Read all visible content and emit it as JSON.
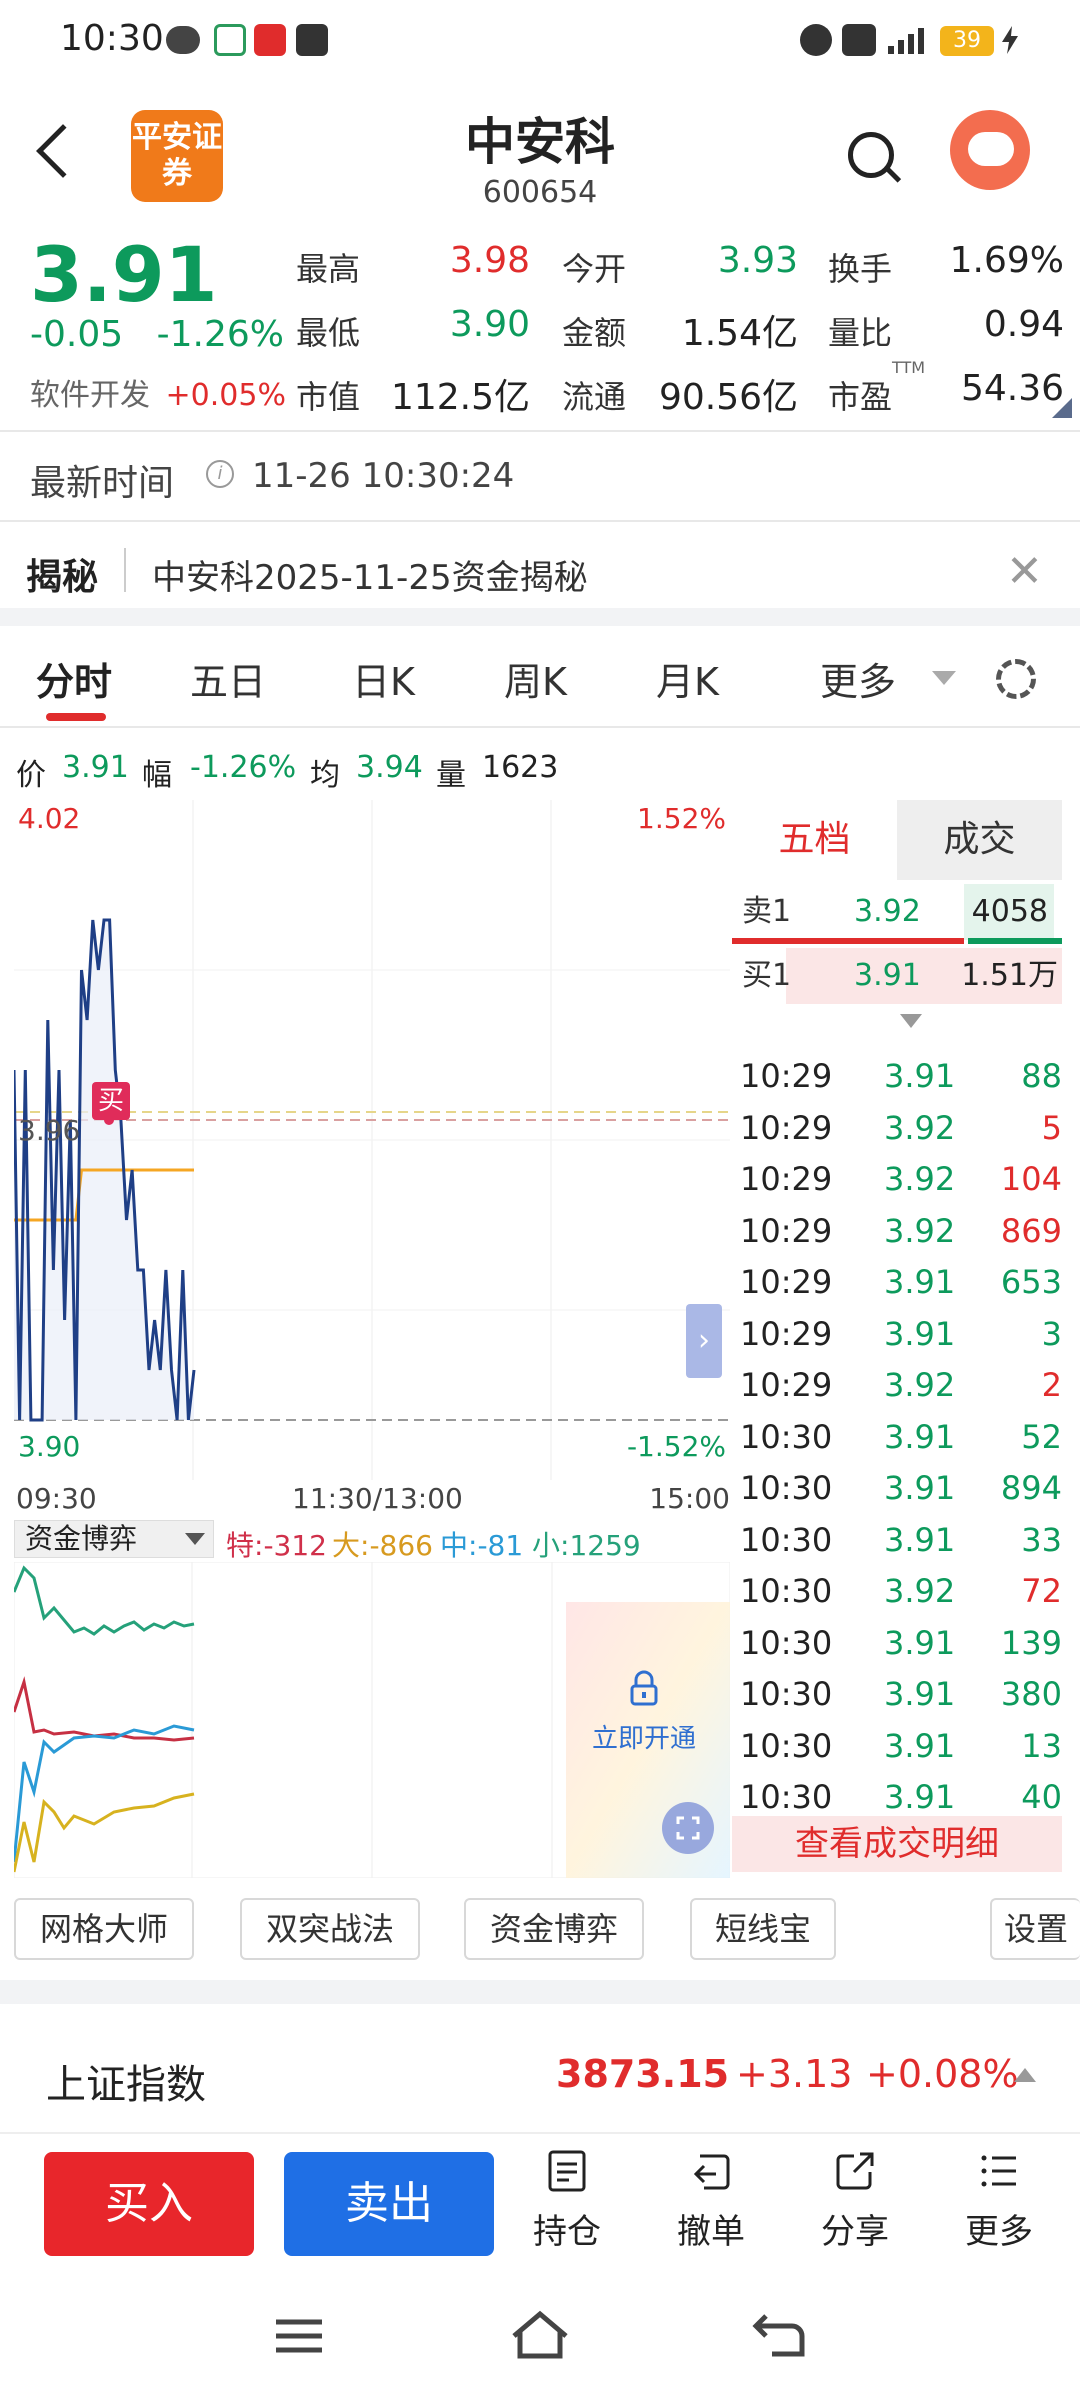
{
  "status_bar": {
    "time": "10:30",
    "battery": "39"
  },
  "header": {
    "logo_text": "平安证券",
    "stock_name": "中安科",
    "stock_code": "600654"
  },
  "quote": {
    "price": "3.91",
    "change": "-0.05",
    "change_pct": "-1.26%",
    "sector_name": "软件开发",
    "sector_pct": "+0.05%",
    "fields": [
      {
        "label": "最高",
        "value": "3.98"
      },
      {
        "label": "今开",
        "value": "3.93"
      },
      {
        "label": "换手",
        "value": "1.69%"
      },
      {
        "label": "最低",
        "value": "3.90"
      },
      {
        "label": "金额",
        "value": "1.54亿"
      },
      {
        "label": "量比",
        "value": "0.94"
      },
      {
        "label": "市值",
        "value": "112.5亿"
      },
      {
        "label": "流通",
        "value": "90.56亿"
      },
      {
        "label": "市盈",
        "value": "54.36",
        "sup": "TTM"
      }
    ]
  },
  "update": {
    "label": "最新时间",
    "time": "11-26 10:30:24"
  },
  "reveal": {
    "tag": "揭秘",
    "text": "中安科2025-11-25资金揭秘"
  },
  "tabs": [
    "分时",
    "五日",
    "日K",
    "周K",
    "月K",
    "更多"
  ],
  "chart_info": {
    "price_label": "价",
    "price": "3.91",
    "amp_label": "幅",
    "amp": "-1.26%",
    "avg_label": "均",
    "avg": "3.94",
    "vol_label": "量",
    "vol": "1623"
  },
  "chart_data": {
    "type": "line",
    "y_max_label": "4.02",
    "y_min_label": "3.90",
    "y_max_pct": "1.52%",
    "y_min_pct": "-1.52%",
    "ref_label": "3.96",
    "buy_marker": "买",
    "ylim": [
      3.9,
      4.02
    ],
    "ref_value": 3.96,
    "x_labels": [
      "09:30",
      "11:30/13:00",
      "15:00"
    ],
    "series": [
      {
        "values": [
          3.97,
          3.9,
          3.97,
          3.9,
          3.9,
          3.9,
          3.98,
          3.93,
          3.97,
          3.92,
          3.96,
          3.9,
          3.99,
          3.98,
          4.0,
          3.99,
          4.0,
          4.0,
          3.97,
          3.96,
          3.94,
          3.95,
          3.93,
          3.93,
          3.91,
          3.92,
          3.91,
          3.93,
          3.91,
          3.9,
          3.93,
          3.9,
          3.91
        ]
      },
      {
        "values": [
          3.94,
          3.94,
          3.94,
          3.94,
          3.94,
          3.94,
          3.94,
          3.94,
          3.94,
          3.94,
          3.94,
          3.94,
          3.95,
          3.95,
          3.95,
          3.95,
          3.95,
          3.95,
          3.95,
          3.95,
          3.95,
          3.95,
          3.95,
          3.95,
          3.95,
          3.95,
          3.95,
          3.95,
          3.95,
          3.95,
          3.95,
          3.95,
          3.95
        ]
      }
    ]
  },
  "flow": {
    "title": "资金博弈",
    "special_label": "特:",
    "special": "-312",
    "large_label": "大:",
    "large": "-866",
    "medium_label": "中:",
    "medium": "-81",
    "small_label": "小:",
    "small": "1259",
    "unlock_text": "立即开通"
  },
  "book": {
    "tab_active": "五档",
    "tab_other": "成交",
    "ask": {
      "label": "卖1",
      "price": "3.92",
      "vol": "4058"
    },
    "bid": {
      "label": "买1",
      "price": "3.91",
      "vol": "1.51万"
    },
    "ticks": [
      {
        "t": "10:29",
        "p": "3.91",
        "v": "88",
        "dir": "down"
      },
      {
        "t": "10:29",
        "p": "3.92",
        "v": "5",
        "dir": "up"
      },
      {
        "t": "10:29",
        "p": "3.92",
        "v": "104",
        "dir": "up"
      },
      {
        "t": "10:29",
        "p": "3.92",
        "v": "869",
        "dir": "up"
      },
      {
        "t": "10:29",
        "p": "3.91",
        "v": "653",
        "dir": "down"
      },
      {
        "t": "10:29",
        "p": "3.91",
        "v": "3",
        "dir": "down"
      },
      {
        "t": "10:29",
        "p": "3.92",
        "v": "2",
        "dir": "up"
      },
      {
        "t": "10:30",
        "p": "3.91",
        "v": "52",
        "dir": "down"
      },
      {
        "t": "10:30",
        "p": "3.91",
        "v": "894",
        "dir": "down"
      },
      {
        "t": "10:30",
        "p": "3.91",
        "v": "33",
        "dir": "down"
      },
      {
        "t": "10:30",
        "p": "3.92",
        "v": "72",
        "dir": "up"
      },
      {
        "t": "10:30",
        "p": "3.91",
        "v": "139",
        "dir": "down"
      },
      {
        "t": "10:30",
        "p": "3.91",
        "v": "380",
        "dir": "down"
      },
      {
        "t": "10:30",
        "p": "3.91",
        "v": "13",
        "dir": "down"
      },
      {
        "t": "10:30",
        "p": "3.91",
        "v": "40",
        "dir": "down"
      }
    ],
    "detail_button": "查看成交明细"
  },
  "tools": [
    "网格大师",
    "双突战法",
    "资金博弈",
    "短线宝",
    "设置"
  ],
  "index": {
    "name": "上证指数",
    "value": "3873.15",
    "change": "+3.13",
    "pct": "+0.08%"
  },
  "bottom": {
    "buy": "买入",
    "sell": "卖出",
    "nav": [
      "持仓",
      "撤单",
      "分享",
      "更多"
    ]
  },
  "colors": {
    "up": "#e02c2c",
    "down": "#0d9a5c",
    "accent": "#e02c2c",
    "sell_button": "#1f6fe5",
    "price_line": "#1f3f86",
    "avg_line": "#f5a623"
  }
}
